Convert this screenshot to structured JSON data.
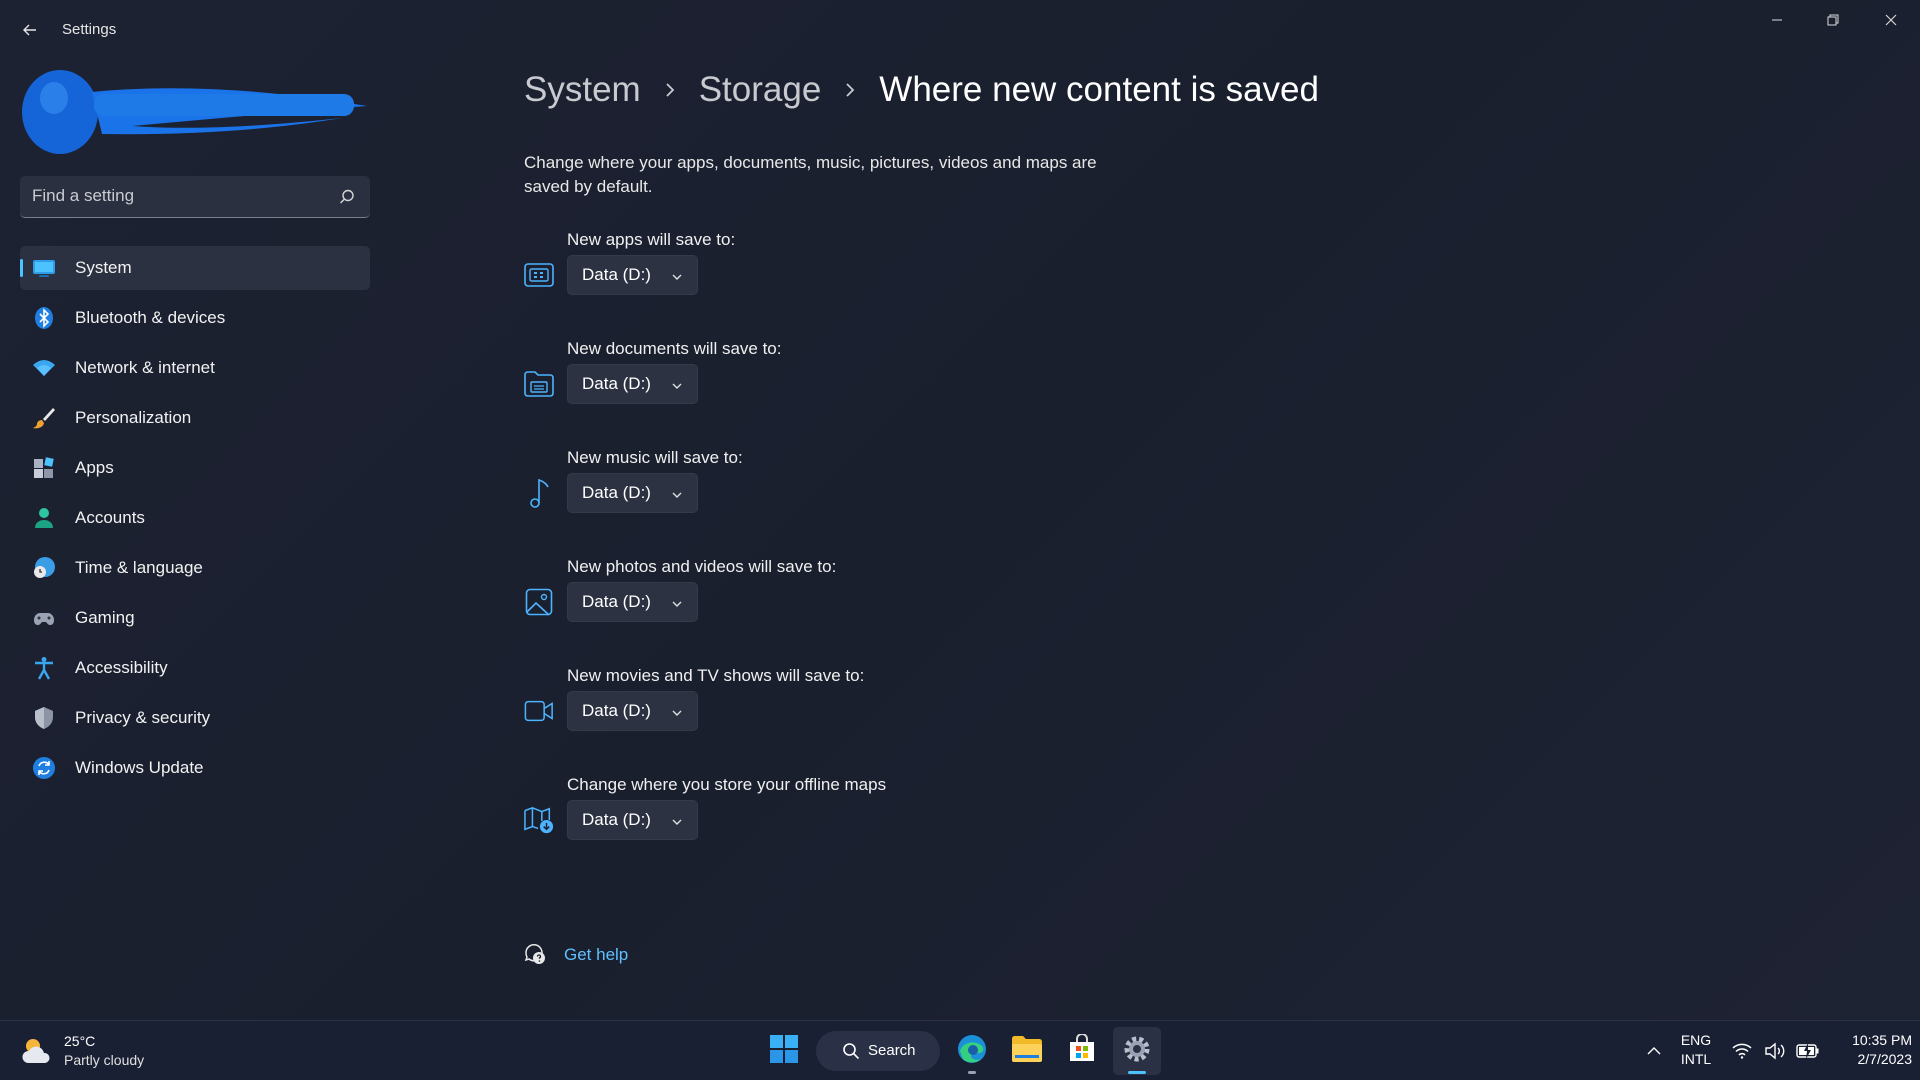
{
  "app": {
    "title": "Settings"
  },
  "search": {
    "placeholder": "Find a setting"
  },
  "sidebar": {
    "items": [
      {
        "label": "System"
      },
      {
        "label": "Bluetooth & devices"
      },
      {
        "label": "Network & internet"
      },
      {
        "label": "Personalization"
      },
      {
        "label": "Apps"
      },
      {
        "label": "Accounts"
      },
      {
        "label": "Time & language"
      },
      {
        "label": "Gaming"
      },
      {
        "label": "Accessibility"
      },
      {
        "label": "Privacy & security"
      },
      {
        "label": "Windows Update"
      }
    ]
  },
  "breadcrumb": [
    "System",
    "Storage",
    "Where new content is saved"
  ],
  "description": "Change where your apps, documents, music, pictures, videos and maps are saved by default.",
  "settings": [
    {
      "label": "New apps will save to:",
      "value": "Data (D:)",
      "icon": "apps-icon"
    },
    {
      "label": "New documents will save to:",
      "value": "Data (D:)",
      "icon": "documents-icon"
    },
    {
      "label": "New music will save to:",
      "value": "Data (D:)",
      "icon": "music-icon"
    },
    {
      "label": "New photos and videos will save to:",
      "value": "Data (D:)",
      "icon": "photos-icon"
    },
    {
      "label": "New movies and TV shows will save to:",
      "value": "Data (D:)",
      "icon": "video-icon"
    },
    {
      "label": "Change where you store your offline maps",
      "value": "Data (D:)",
      "icon": "map-icon"
    }
  ],
  "help": {
    "label": "Get help"
  },
  "taskbar": {
    "weather": {
      "temp": "25°C",
      "desc": "Partly cloudy"
    },
    "search_label": "Search",
    "lang": {
      "line1": "ENG",
      "line2": "INTL"
    },
    "clock": {
      "time": "10:35 PM",
      "date": "2/7/2023"
    }
  },
  "colors": {
    "accent": "#4cc2ff",
    "link": "#5fc0ff",
    "background": "#1c2131"
  }
}
